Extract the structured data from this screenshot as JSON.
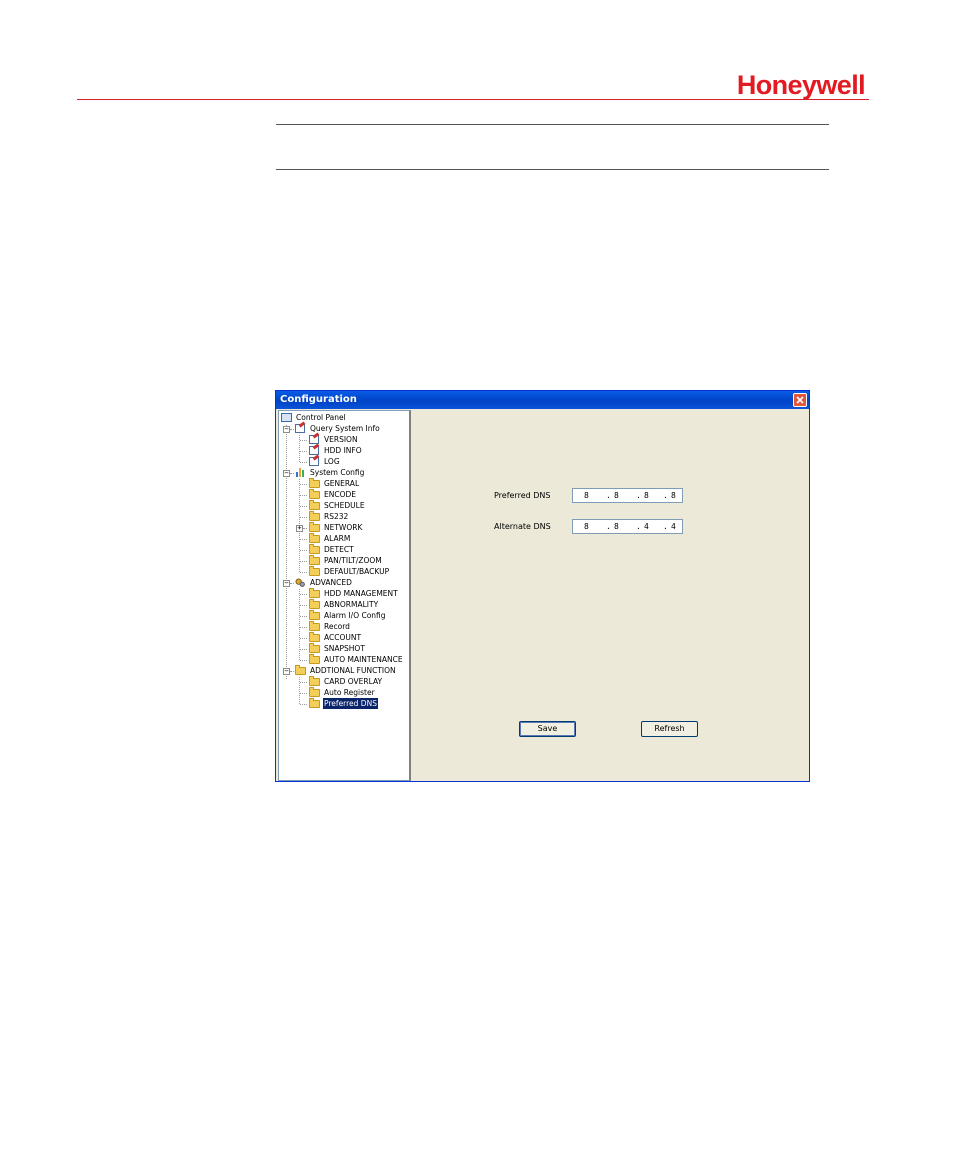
{
  "brand": {
    "logo_text": "Honeywell",
    "color": "#e21a22"
  },
  "window": {
    "title": "Configuration",
    "title_bar_color": "#0a5ce6"
  },
  "tree": {
    "root": "Control Panel",
    "query_system_info": {
      "label": "Query System Info",
      "children": [
        "VERSION",
        "HDD INFO",
        "LOG"
      ]
    },
    "system_config": {
      "label": "System Config",
      "children": [
        "GENERAL",
        "ENCODE",
        "SCHEDULE",
        "RS232",
        "NETWORK",
        "ALARM",
        "DETECT",
        "PAN/TILT/ZOOM",
        "DEFAULT/BACKUP"
      ]
    },
    "advanced": {
      "label": "ADVANCED",
      "children": [
        "HDD MANAGEMENT",
        "ABNORMALITY",
        "Alarm I/O Config",
        "Record",
        "ACCOUNT",
        "SNAPSHOT",
        "AUTO MAINTENANCE"
      ]
    },
    "additional_function": {
      "label": "ADDTIONAL FUNCTION",
      "children": [
        "CARD OVERLAY",
        "Auto Register",
        "Preferred DNS"
      ]
    },
    "selected": "Preferred DNS"
  },
  "form": {
    "preferred_dns_label": "Preferred DNS",
    "preferred_dns": [
      "8",
      "8",
      "8",
      "8"
    ],
    "alternate_dns_label": "Alternate DNS",
    "alternate_dns": [
      "8",
      "8",
      "4",
      "4"
    ],
    "dot": "."
  },
  "buttons": {
    "save": "Save",
    "refresh": "Refresh"
  }
}
